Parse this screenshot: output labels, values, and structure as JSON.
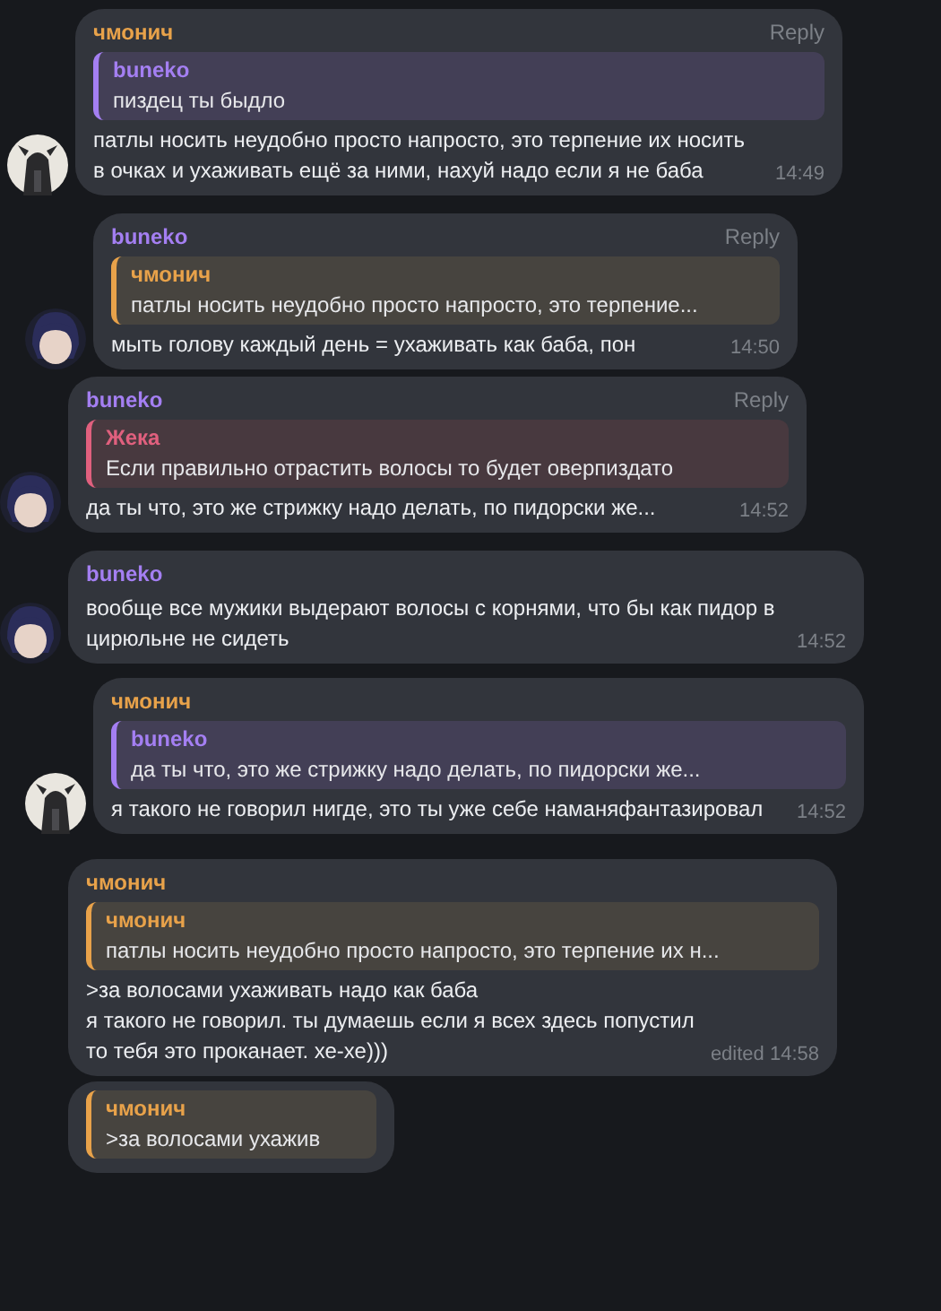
{
  "messages": [
    {
      "sender": "чмонич",
      "color": "#e8a24a",
      "reply_label": "Reply",
      "quote": {
        "sender": "buneko",
        "color": "#a47ff2",
        "text": "пиздец ты быдло"
      },
      "text": "патлы носить неудобно просто напросто, это терпение их носить в очках и ухаживать ещё за ними, нахуй надо если я не баба",
      "time": "14:49"
    },
    {
      "sender": "buneko",
      "color": "#a47ff2",
      "reply_label": "Reply",
      "quote": {
        "sender": "чмонич",
        "color": "#e8a24a",
        "text": "патлы носить неудобно просто напросто, это терпение..."
      },
      "text": "мыть голову каждый день = ухаживать как баба, пон",
      "time": "14:50"
    },
    {
      "sender": "buneko",
      "color": "#a47ff2",
      "reply_label": "Reply",
      "quote": {
        "sender": "Жека",
        "color": "#e0607e",
        "text": "Если правильно отрастить волосы то будет оверпиздато"
      },
      "text": "да ты что, это же стрижку надо делать, по пидорски же...",
      "time": "14:52"
    },
    {
      "sender": "buneko",
      "color": "#a47ff2",
      "text": "вообще все мужики выдерают волосы с корнями, что бы как пидор в цирюльне не сидеть",
      "time": "14:52"
    },
    {
      "sender": "чмонич",
      "color": "#e8a24a",
      "quote": {
        "sender": "buneko",
        "color": "#a47ff2",
        "text": "да ты что, это же стрижку надо делать, по пидорски же..."
      },
      "text": "я такого не говорил нигде, это ты уже себе наманяфантазировал",
      "time": "14:52"
    },
    {
      "sender": "чмонич",
      "color": "#e8a24a",
      "quote": {
        "sender": "чмонич",
        "color": "#e8a24a",
        "text": "патлы носить неудобно просто напросто, это терпение их н..."
      },
      "text": ">за волосами ухаживать надо как баба\nя такого не говорил. ты думаешь если я всех здесь попустил то тебя это проканает. хе-хе)))",
      "time": "edited 14:58"
    },
    {
      "quote": {
        "sender": "чмонич",
        "color": "#e8a24a",
        "text": ">за волосами ухажив"
      }
    }
  ]
}
